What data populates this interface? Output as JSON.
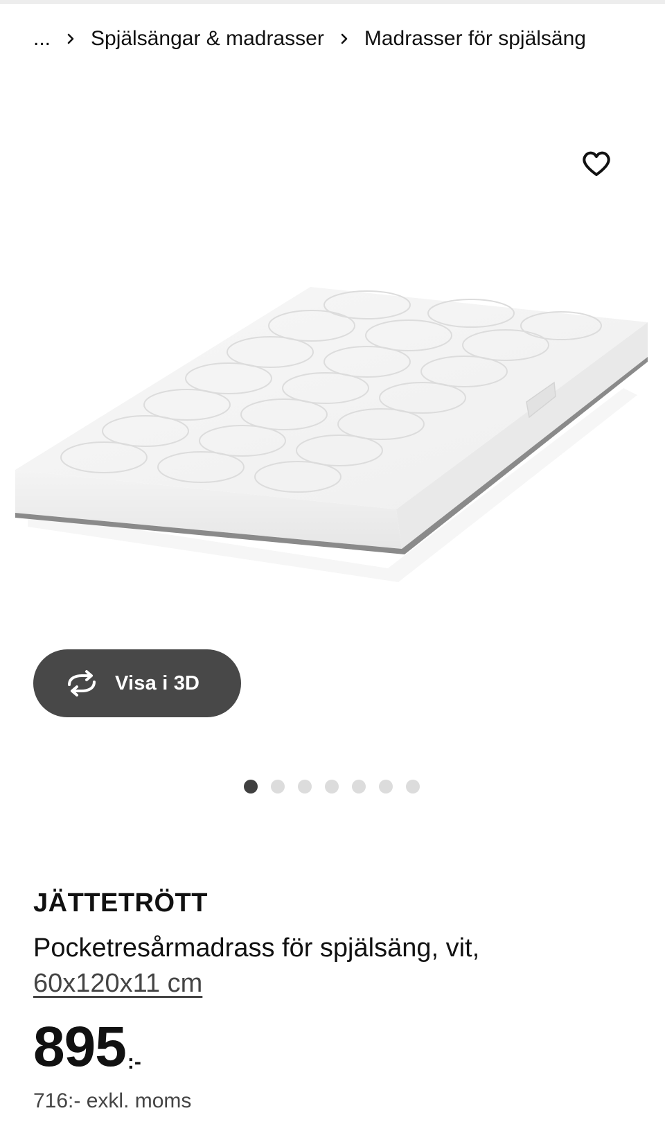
{
  "breadcrumb": {
    "ellipsis": "...",
    "items": [
      {
        "label": "Spjälsängar & madrasser"
      },
      {
        "label": "Madrasser för spjälsäng"
      }
    ]
  },
  "gallery": {
    "view3d_label": "Visa i 3D",
    "image_count": 7,
    "active_index": 0
  },
  "product": {
    "name": "JÄTTETRÖTT",
    "description": "Pocketresårmadrass för spjälsäng, vit,",
    "size": "60x120x11 cm",
    "price": "895",
    "price_suffix": ":-",
    "price_ex_vat": "716:- exkl. moms"
  },
  "colors": {
    "pill_bg": "#484848",
    "dot_active": "#404040",
    "dot_inactive": "#dcdcdc"
  },
  "icons": {
    "favorite": "heart-outline-icon",
    "view3d": "rotate-3d-icon",
    "separator": "chevron-right-icon"
  }
}
